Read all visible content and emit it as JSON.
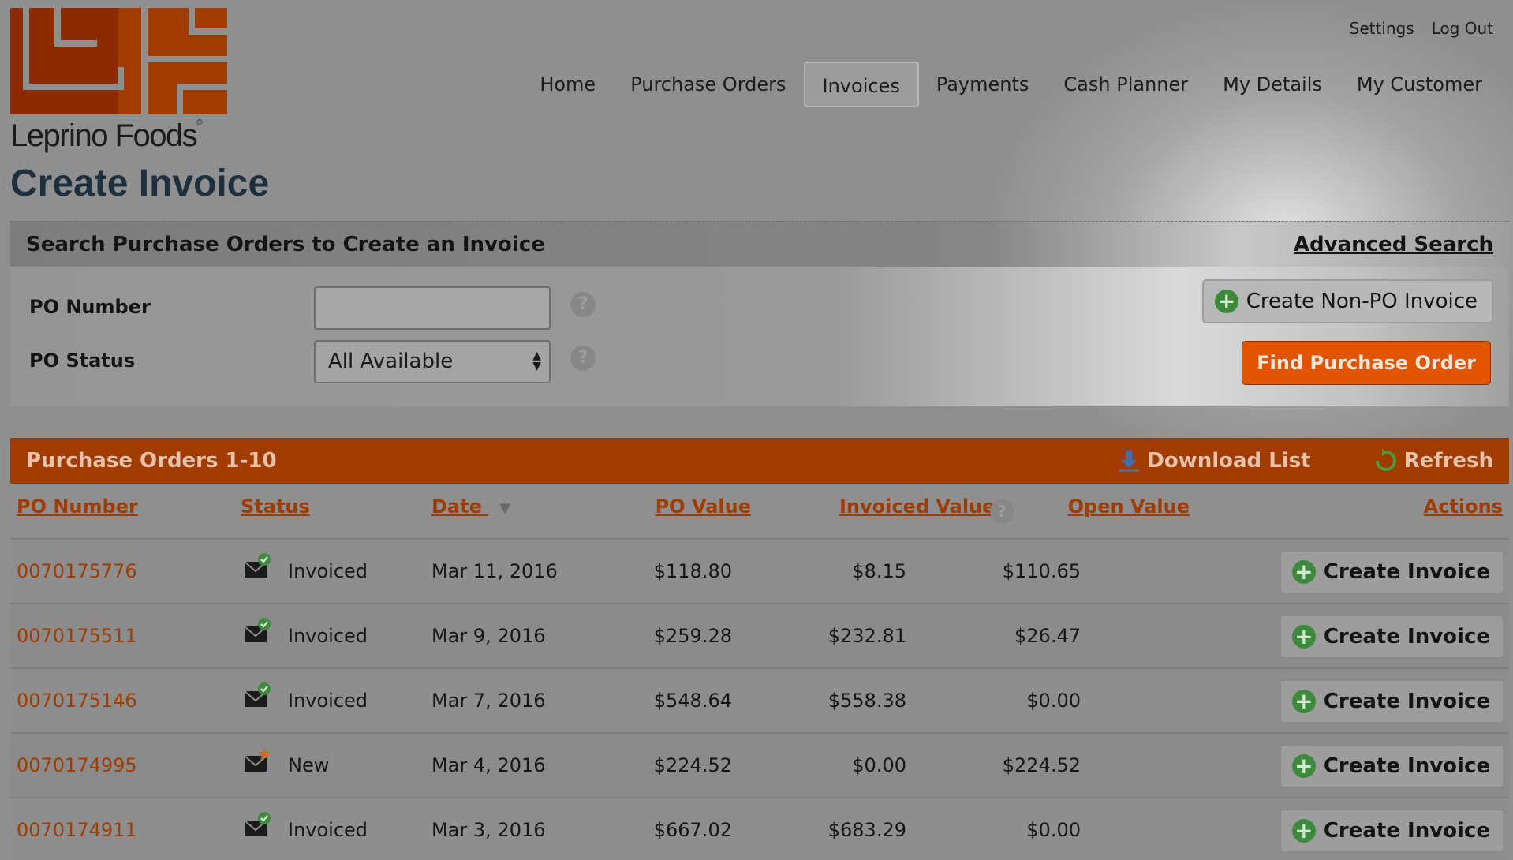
{
  "brand": {
    "name": "Leprino Foods",
    "color": "#a13c00"
  },
  "top_links": {
    "settings": "Settings",
    "logout": "Log Out"
  },
  "nav": {
    "home": "Home",
    "purchase_orders": "Purchase Orders",
    "invoices": "Invoices",
    "payments": "Payments",
    "cash_planner": "Cash Planner",
    "my_details": "My Details",
    "my_customer": "My Customer",
    "active": "Invoices"
  },
  "page_title": "Create Invoice",
  "search": {
    "header": "Search Purchase Orders to Create an Invoice",
    "advanced_link": "Advanced Search",
    "po_number_label": "PO Number",
    "po_number_value": "",
    "po_status_label": "PO Status",
    "po_status_selected": "All Available",
    "create_non_po_label": "Create Non-PO Invoice",
    "find_label": "Find Purchase Order"
  },
  "po_list": {
    "title": "Purchase Orders 1-10",
    "download_label": "Download List",
    "refresh_label": "Refresh",
    "columns": {
      "po_number": "PO Number",
      "status": "Status",
      "date": "Date",
      "po_value": "PO Value",
      "invoiced_value": "Invoiced Value",
      "open_value": "Open Value",
      "actions": "Actions"
    },
    "sort": {
      "column": "Date",
      "direction": "descending"
    },
    "action_label": "Create Invoice",
    "rows": [
      {
        "po_number": "0070175776",
        "status": "Invoiced",
        "status_icon": "envelope-check-icon",
        "date": "Mar 11, 2016",
        "po_value": "$118.80",
        "invoiced_value": "$8.15",
        "open_value": "$110.65"
      },
      {
        "po_number": "0070175511",
        "status": "Invoiced",
        "status_icon": "envelope-check-icon",
        "date": "Mar 9, 2016",
        "po_value": "$259.28",
        "invoiced_value": "$232.81",
        "open_value": "$26.47"
      },
      {
        "po_number": "0070175146",
        "status": "Invoiced",
        "status_icon": "envelope-check-icon",
        "date": "Mar 7, 2016",
        "po_value": "$548.64",
        "invoiced_value": "$558.38",
        "open_value": "$0.00"
      },
      {
        "po_number": "0070174995",
        "status": "New",
        "status_icon": "envelope-new-icon",
        "date": "Mar 4, 2016",
        "po_value": "$224.52",
        "invoiced_value": "$0.00",
        "open_value": "$224.52"
      },
      {
        "po_number": "0070174911",
        "status": "Invoiced",
        "status_icon": "envelope-check-icon",
        "date": "Mar 3, 2016",
        "po_value": "$667.02",
        "invoiced_value": "$683.29",
        "open_value": "$0.00"
      }
    ]
  }
}
